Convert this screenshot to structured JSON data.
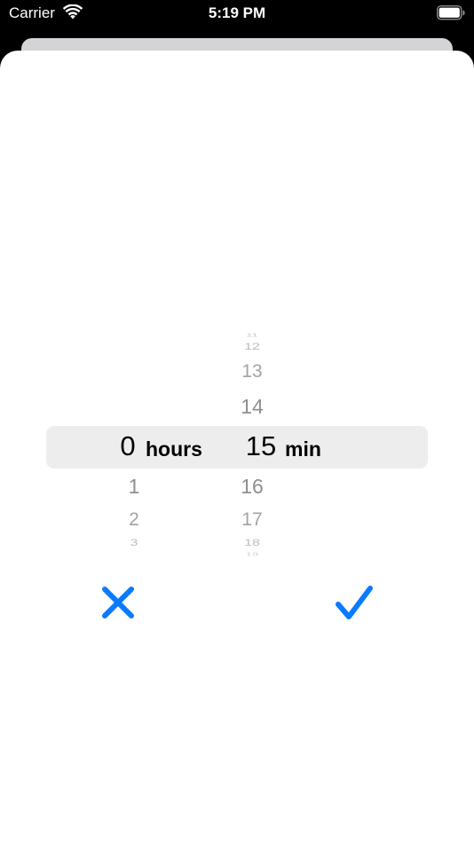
{
  "status_bar": {
    "carrier": "Carrier",
    "time": "5:19 PM",
    "wifi_icon": "wifi-icon",
    "battery_icon": "battery-icon"
  },
  "picker": {
    "hours": {
      "above": [],
      "selected": "0",
      "unit": "hours",
      "below": [
        "1",
        "2",
        "3"
      ]
    },
    "minutes": {
      "above": [
        "11",
        "12",
        "13",
        "14"
      ],
      "selected": "15",
      "unit": "min",
      "below": [
        "16",
        "17",
        "18",
        "19"
      ]
    }
  },
  "actions": {
    "cancel_icon": "close-icon",
    "confirm_icon": "checkmark-icon"
  },
  "colors": {
    "accent": "#0a7aff",
    "highlight": "#ededee",
    "muted_text": "#9b9b9f"
  }
}
